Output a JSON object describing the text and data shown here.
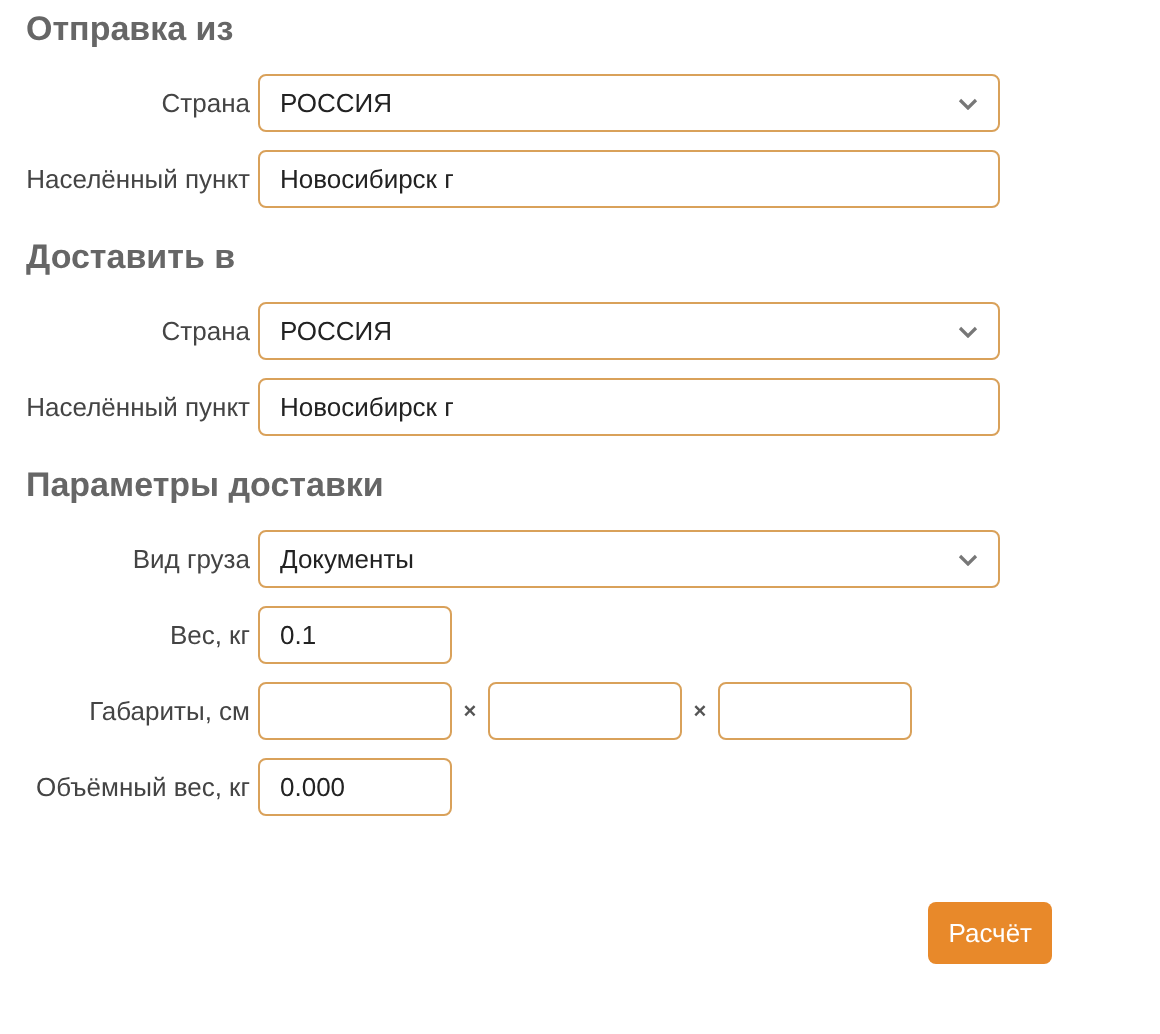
{
  "sections": [
    {
      "title": "Отправка из",
      "fields": [
        {
          "kind": "select",
          "label": "Страна",
          "value": "РОССИЯ"
        },
        {
          "kind": "text",
          "label": "Населённый пункт",
          "value": "Новосибирск г"
        }
      ]
    },
    {
      "title": "Доставить в",
      "fields": [
        {
          "kind": "select",
          "label": "Страна",
          "value": "РОССИЯ"
        },
        {
          "kind": "text",
          "label": "Населённый пункт",
          "value": "Новосибирск г"
        }
      ]
    },
    {
      "title": "Параметры доставки",
      "fields": [
        {
          "kind": "select",
          "label": "Вид груза",
          "value": "Документы"
        },
        {
          "kind": "short",
          "label": "Вес, кг",
          "value": "0.1"
        },
        {
          "kind": "dims",
          "label": "Габариты, см",
          "separators": [
            "×",
            "×"
          ]
        },
        {
          "kind": "short",
          "label": "Объёмный вес, кг",
          "value": "0.000"
        }
      ]
    }
  ],
  "button": "Расчёт"
}
